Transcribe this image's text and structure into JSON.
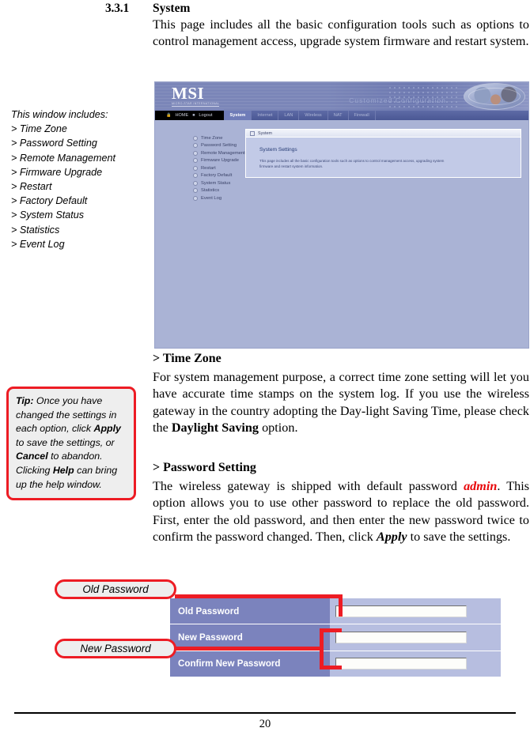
{
  "section": {
    "number": "3.3.1",
    "title": "System",
    "intro": "This page includes all the basic configuration tools such as options to control management access, upgrade system firmware and restart system."
  },
  "margin_note": {
    "heading": "This window includes:",
    "items": [
      "> Time Zone",
      "> Password Setting",
      "> Remote Management",
      "> Firmware Upgrade",
      "> Restart",
      "> Factory Default",
      "> System Status",
      "> Statistics",
      "> Event Log"
    ]
  },
  "screenshot": {
    "brand": "MSI",
    "brand_sub": "MICRO-STAR INTERNATIONAL",
    "tagline": "Customized Configuration",
    "home_label": "HOME",
    "logout_label": "Logout",
    "tabs": [
      "System",
      "Internet",
      "LAN",
      "Wireless",
      "NAT",
      "Firewall"
    ],
    "active_tab": "System",
    "menu_items": [
      "Time Zone",
      "Password Setting",
      "Remote Management",
      "Firmware Upgrade",
      "Restart",
      "Factory Default",
      "System Status",
      "Statistics",
      "Event Log"
    ],
    "panel_tab": "System",
    "panel_title": "System Settings",
    "panel_text": "This page includes all the basic configuration tools such as options to control management access, upgrading system firmware and restart system information."
  },
  "time_zone": {
    "heading": "> Time Zone",
    "body_1": "For system management purpose, a correct time zone setting will let you have accurate time stamps on the system log.  If you use the wireless gateway in the country adopting the Day-light Saving Time, please check the ",
    "bold_term": "Daylight Saving",
    "body_2": " option."
  },
  "password_setting": {
    "heading": "> Password Setting",
    "body_1": "The wireless gateway is shipped with default password ",
    "default_password": "admin",
    "body_2": ". This option allows you to use other password to replace the old password.  First, enter the old password, and then enter the new password twice to confirm the password changed.  Then, click ",
    "apply_term": "Apply",
    "body_3": " to save the settings."
  },
  "tip": {
    "label": "Tip:",
    "text_1": " Once you have changed the settings in each option, click ",
    "apply": "Apply",
    "text_2": " to save the settings, or ",
    "cancel": "Cancel",
    "text_3": " to abandon.  Clicking ",
    "help": "Help",
    "text_4": " can bring up the help window."
  },
  "password_form": {
    "rows": [
      {
        "label": "Old Password",
        "value": ""
      },
      {
        "label": "New Password",
        "value": ""
      },
      {
        "label": "Confirm New Password",
        "value": ""
      }
    ],
    "callouts": [
      {
        "label": "Old Password"
      },
      {
        "label": "New Password"
      }
    ]
  },
  "footer": {
    "page_number": "20"
  },
  "colors": {
    "callout_red": "#ed1c24",
    "accent_blue": "#7b83bd",
    "field_bg": "#b7bee0",
    "highlight_red": "#e8070a"
  }
}
